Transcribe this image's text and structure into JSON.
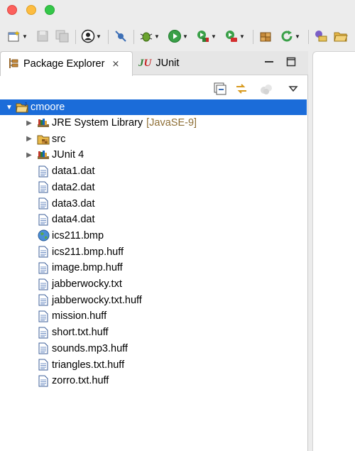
{
  "window": {
    "buttons": [
      "close",
      "minimize",
      "zoom"
    ]
  },
  "toolbar": {
    "icons": [
      "new-wizard-icon",
      "save-icon",
      "save-all-icon",
      "person-icon",
      "skip-breakpoints-icon",
      "debug-icon",
      "run-icon",
      "run-coverage-icon",
      "run-external-tool-icon",
      "new-package-icon",
      "refresh-icon",
      "open-type-icon",
      "open-folder-icon"
    ]
  },
  "tabs": {
    "active_label": "Package Explorer",
    "other_label": "JUnit",
    "close_glyph": "⨯"
  },
  "tree": {
    "project": "cmoore",
    "items": [
      {
        "label": "JRE System Library",
        "suffix": "[JavaSE-9]",
        "kind": "library",
        "expandable": true
      },
      {
        "label": "src",
        "suffix": "",
        "kind": "package-folder",
        "expandable": true
      },
      {
        "label": "JUnit 4",
        "suffix": "",
        "kind": "library",
        "expandable": true
      },
      {
        "label": "data1.dat",
        "kind": "file"
      },
      {
        "label": "data2.dat",
        "kind": "file"
      },
      {
        "label": "data3.dat",
        "kind": "file"
      },
      {
        "label": "data4.dat",
        "kind": "file"
      },
      {
        "label": "ics211.bmp",
        "kind": "globe"
      },
      {
        "label": "ics211.bmp.huff",
        "kind": "file"
      },
      {
        "label": "image.bmp.huff",
        "kind": "file"
      },
      {
        "label": "jabberwocky.txt",
        "kind": "file"
      },
      {
        "label": "jabberwocky.txt.huff",
        "kind": "file"
      },
      {
        "label": "mission.huff",
        "kind": "file"
      },
      {
        "label": "short.txt.huff",
        "kind": "file"
      },
      {
        "label": "sounds.mp3.huff",
        "kind": "file"
      },
      {
        "label": "triangles.txt.huff",
        "kind": "file"
      },
      {
        "label": "zorro.txt.huff",
        "kind": "file"
      }
    ]
  },
  "colors": {
    "selection": "#1b6cd9",
    "library_suffix": "#8d6e35"
  }
}
